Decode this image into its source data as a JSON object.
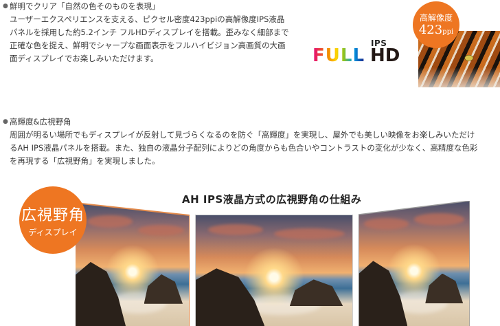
{
  "section1": {
    "heading": "鮮明でクリア「自然の色そのものを表現」",
    "lines": [
      "ユーザーエクスペリエンスを支える、ピクセル密度423ppiの高解像度IPS液晶",
      "パネルを採用した約5.2インチ フルHDディスプレイを搭載。歪みなく細部まで",
      "正確な色を捉え、鮮明でシャープな画面表示をフルハイビジョン高画質の大画",
      "面ディスプレイでお楽しみいただけます。"
    ]
  },
  "logo": {
    "ips": "IPS",
    "full": "FULL",
    "hd": "HD"
  },
  "badge_resolution": {
    "line1": "高解像度",
    "value": "423",
    "unit": "ppi"
  },
  "section2": {
    "heading": "高輝度&広視野角",
    "lines": [
      "周囲が明るい場所でもディスプレイが反射して見づらくなるのを防ぐ「高輝度」を実現し、屋外でも美しい映像をお楽しみいただけ",
      "るAH IPS液晶パネルを搭載。また、独自の液晶分子配列によりどの角度からも色合いやコントラストの変化が少なく、高精度な色彩",
      "を再現する「広視野角」を実現しました。"
    ]
  },
  "diagram": {
    "title": "AH IPS液晶方式の広視野角の仕組み"
  },
  "badge_viewing": {
    "line1": "広視野角",
    "line2": "ディスプレイ"
  },
  "colors": {
    "accent_orange": "#ee7622",
    "text": "#3a3a3a"
  }
}
